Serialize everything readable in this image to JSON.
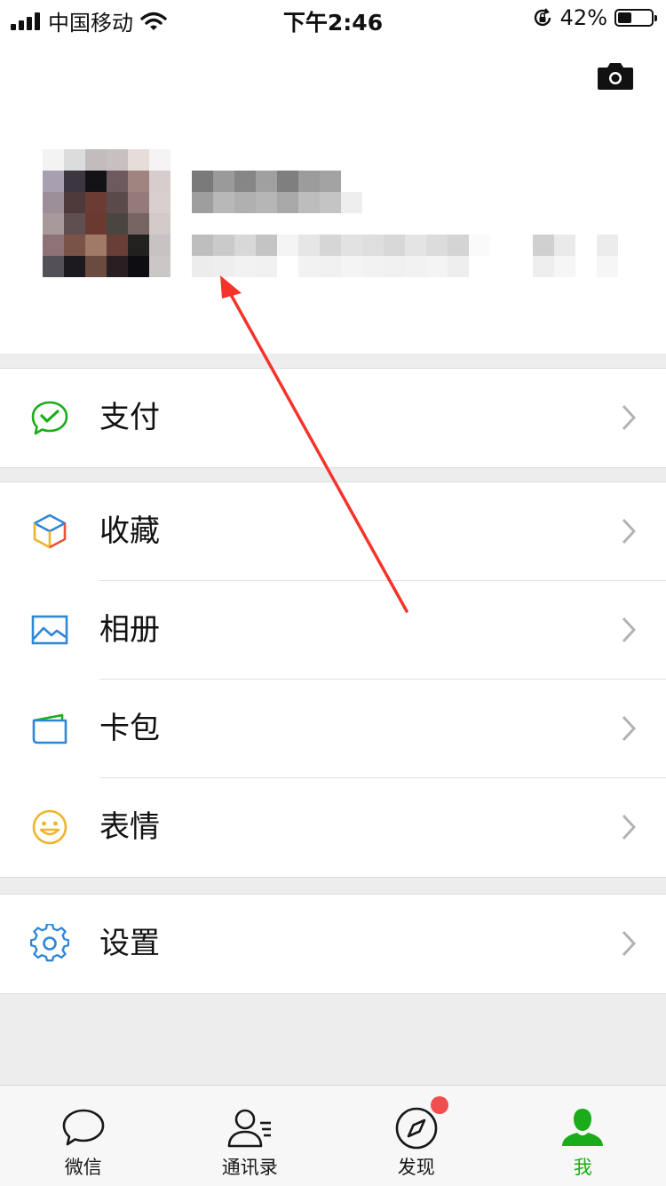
{
  "status_bar": {
    "carrier": "中国移动",
    "time": "下午2:46",
    "battery_percent": "42%",
    "battery_level": 0.42
  },
  "profile": {
    "avatar_pixels": [
      [
        "#f3f3f3",
        "#dcdcdc",
        "#c2bcbc",
        "#c8c0c0",
        "#e6dcda",
        "#f5f3f3"
      ],
      [
        "#a8a0b0",
        "#3b3640",
        "#131217",
        "#6d5a5f",
        "#a08480",
        "#d7cdcd"
      ],
      [
        "#9c8f9a",
        "#4e3a3a",
        "#6b3c33",
        "#5a4a4a",
        "#947a78",
        "#d8cfcf"
      ],
      [
        "#a89a9c",
        "#5f4f50",
        "#6a3a30",
        "#4b4540",
        "#756460",
        "#d2c9c9"
      ],
      [
        "#8e7277",
        "#7a5346",
        "#a07a66",
        "#693e36",
        "#232020",
        "#c8c2c2"
      ],
      [
        "#545058",
        "#1c1a1e",
        "#6b4a40",
        "#2a1e22",
        "#0e0d12",
        "#cbc7c7"
      ]
    ],
    "name_blur_row1": [
      "#7a7a7a",
      "#9a9a9a",
      "#868686",
      "#a0a0a0",
      "#7f7f7f",
      "#9c9c9c",
      "#a3a3a3",
      "#ffffff"
    ],
    "name_blur_row2": [
      "#9e9e9e",
      "#b8b8b8",
      "#b0b0b0",
      "#b6b6b6",
      "#a8a8a8",
      "#bdbdbd",
      "#c4c4c4",
      "#eeeeee"
    ],
    "id_blur_row1": [
      "#bebebe",
      "#cacaca",
      "#d8d8d8",
      "#c4c4c4",
      "#f4f4f4",
      "#e6e6e6",
      "#d6d6d6",
      "#e2e2e2",
      "#dedede",
      "#d8d8d8",
      "#e4e4e4",
      "#dcdcdc",
      "#d4d4d4",
      "#fafafa",
      "#ffffff",
      "#ffffff",
      "#d0d0d0",
      "#eaeaea",
      "#ffffff",
      "#ececec"
    ],
    "id_blur_row2": [
      "#ececec",
      "#eeeeee",
      "#f2f2f2",
      "#f0f0f0",
      "#ffffff",
      "#f2f2f2",
      "#f0f0f0",
      "#f4f4f4",
      "#f2f2f2",
      "#f0f0f0",
      "#f2f2f2",
      "#f4f4f4",
      "#eeeeee",
      "#ffffff",
      "#ffffff",
      "#ffffff",
      "#eeeeee",
      "#f6f6f6",
      "#ffffff",
      "#f6f6f6"
    ]
  },
  "menu": {
    "pay": "支付",
    "favorites": "收藏",
    "album": "相册",
    "cards": "卡包",
    "stickers": "表情",
    "settings": "设置"
  },
  "tabbar": {
    "chats": "微信",
    "contacts": "通讯录",
    "discover": "发现",
    "me": "我"
  },
  "colors": {
    "accent": "#1aad19",
    "annotation_arrow": "#f5332b",
    "badge": "#f04e4e",
    "icon_blue": "#2f87d8"
  }
}
